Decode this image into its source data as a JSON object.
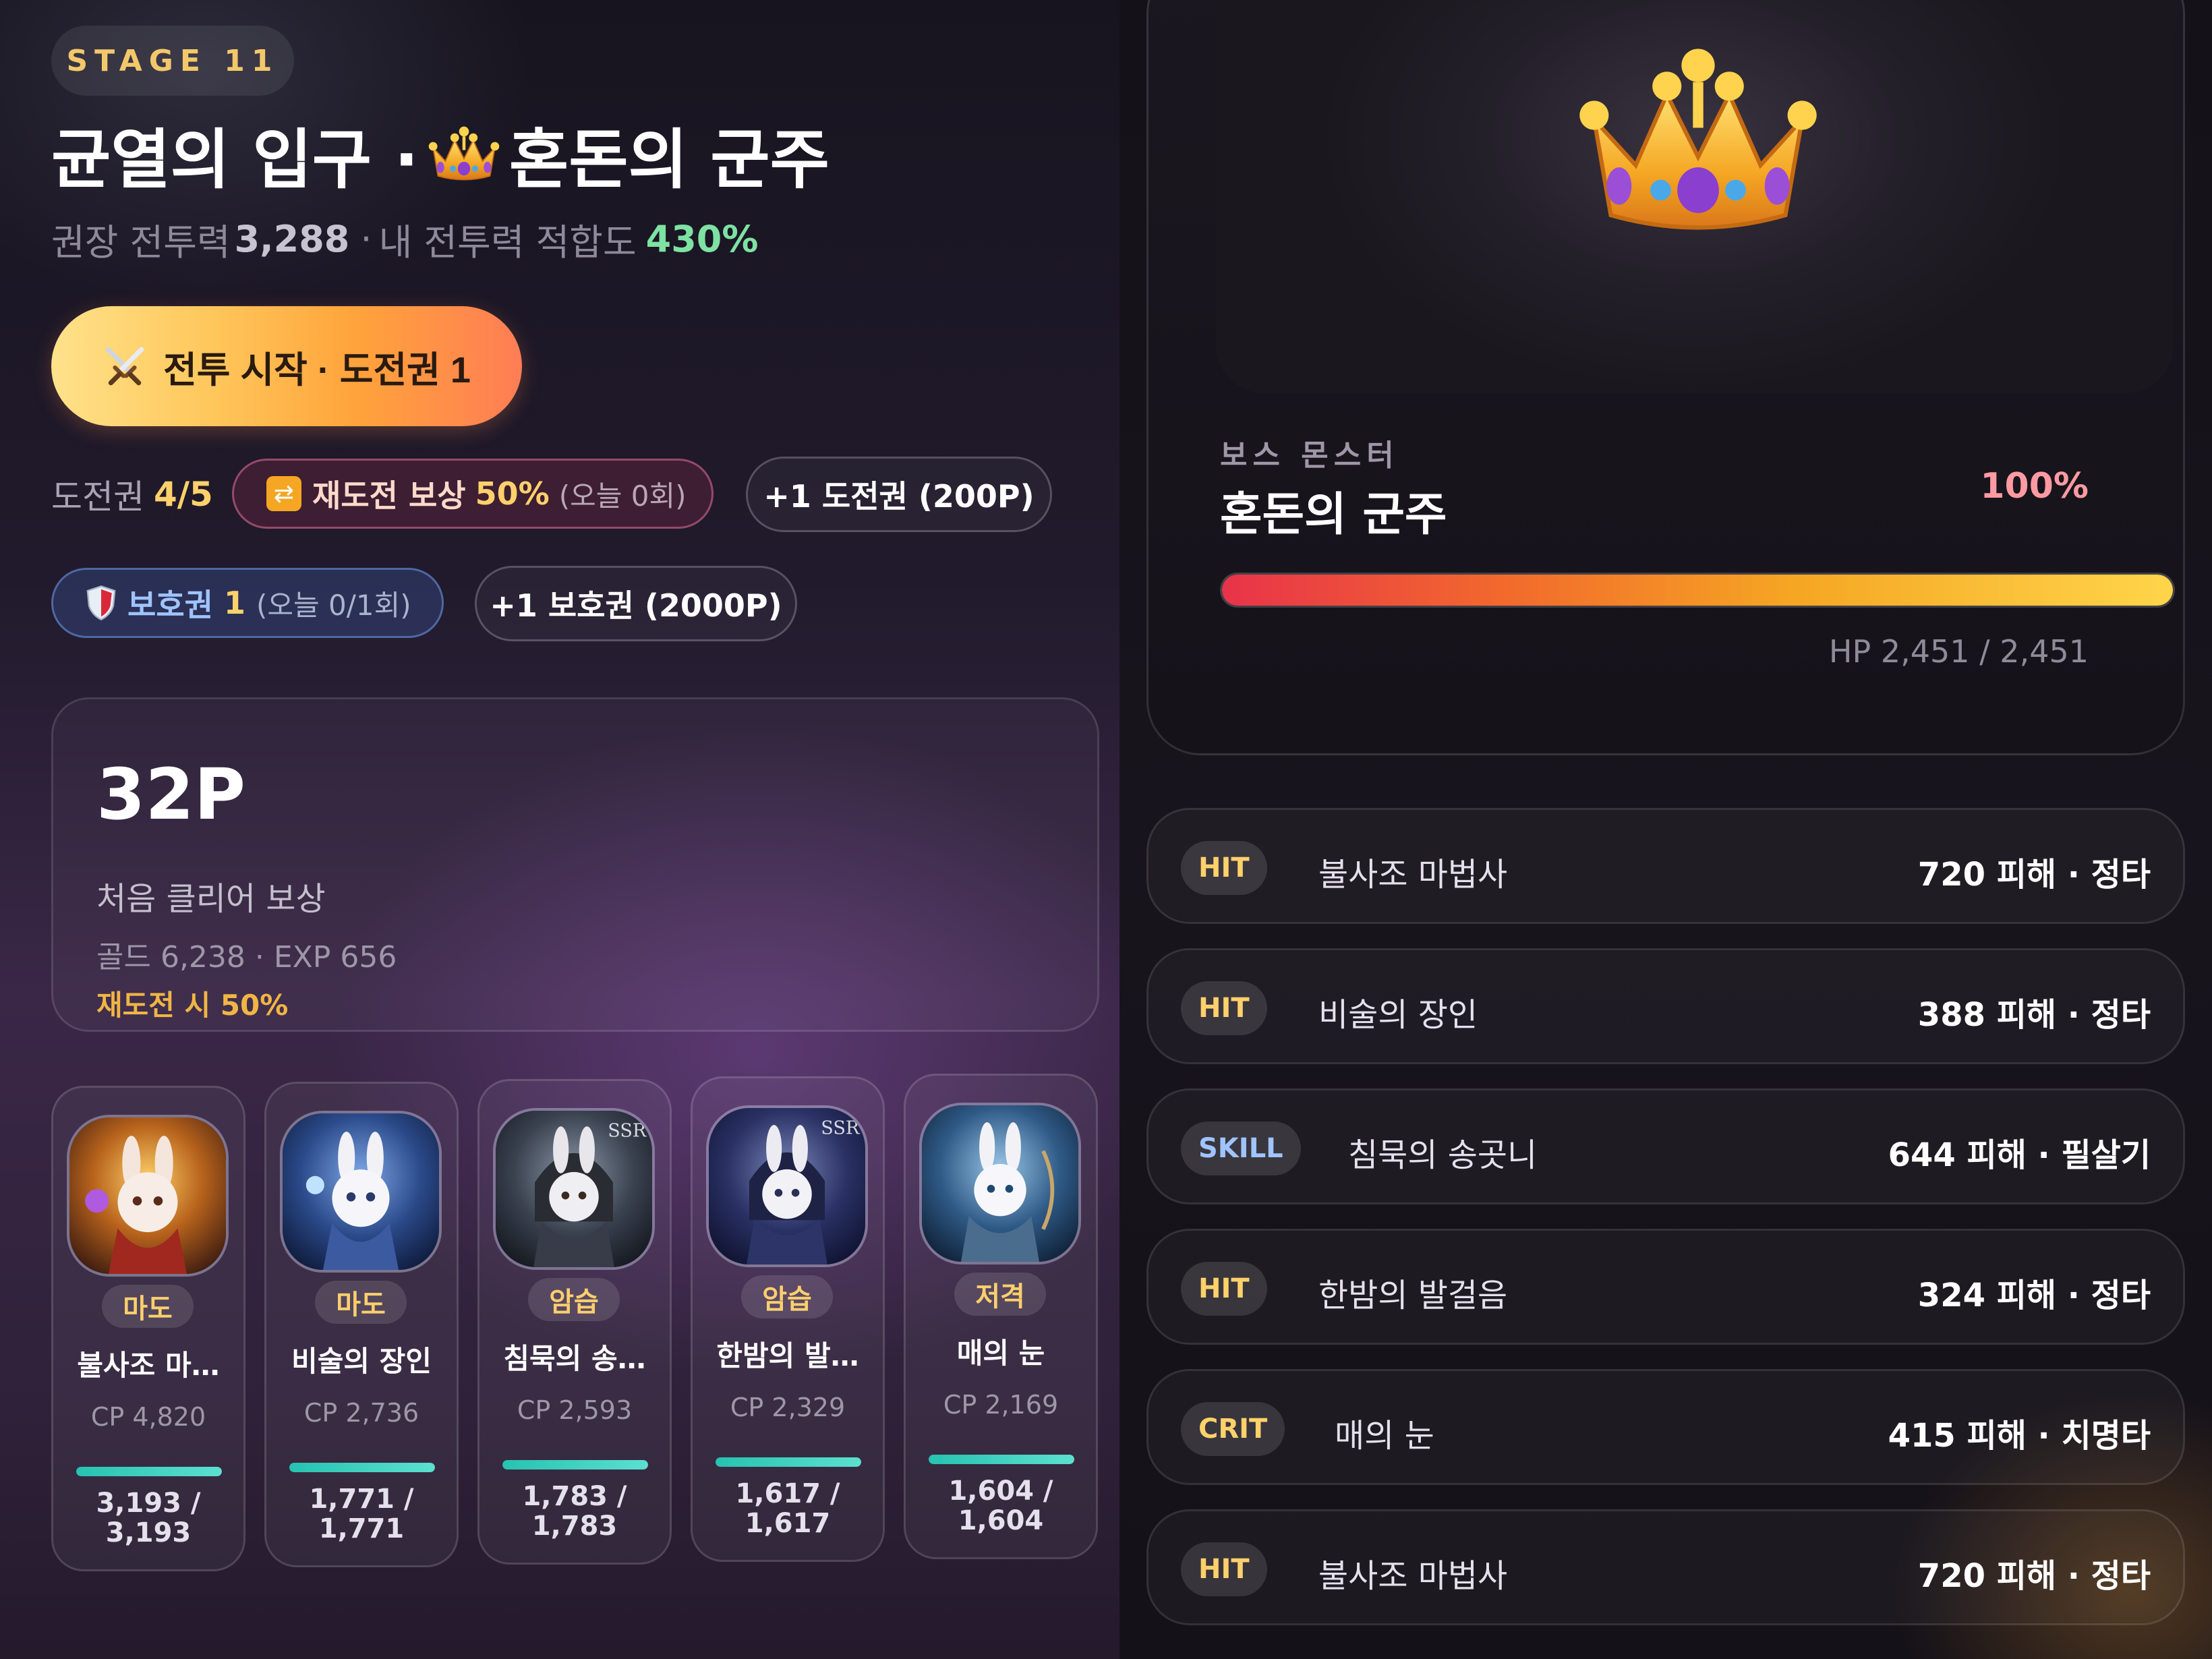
{
  "stage": {
    "label": "STAGE 11"
  },
  "header": {
    "title_left": "균열의 입구 ·",
    "title_right": "혼돈의 군주",
    "title_icon": "crown-icon",
    "recommend_label": "권장 전투력",
    "recommend_value": "3,288",
    "separator": "·",
    "fit_label": "내 전투력 적합도",
    "fit_value": "430%"
  },
  "start_button": {
    "icon": "crossed-swords-icon",
    "label": "전투 시작 · 도전권 1"
  },
  "tickets": {
    "label": "도전권",
    "value": "4/5",
    "retry_reward": {
      "icon": "repeat-icon",
      "label": "재도전 보상",
      "percent": "50%",
      "today": "(오늘 0회)"
    },
    "buy_ticket_label": "+1 도전권 (200P)"
  },
  "shields": {
    "icon": "shield-icon",
    "label": "보호권",
    "count": "1",
    "today": "(오늘 0/1회)",
    "buy_label": "+1 보호권 (2000P)"
  },
  "reward": {
    "points": "32P",
    "first_clear": "처음 클리어 보상",
    "gold_exp": "골드 6,238 · EXP 656",
    "retry_note": "재도전 시 50%"
  },
  "heroes": [
    {
      "role": "마도",
      "name": "불사조 마…",
      "cp": "CP 4,820",
      "hp_line1": "3,193 /",
      "hp_line2": "3,193",
      "hp_ratio": 1.0
    },
    {
      "role": "마도",
      "name": "비술의 장인",
      "cp": "CP 2,736",
      "hp_line1": "1,771 /",
      "hp_line2": "1,771",
      "hp_ratio": 1.0
    },
    {
      "role": "암습",
      "name": "침묵의 송…",
      "cp": "CP 2,593",
      "hp_line1": "1,783 /",
      "hp_line2": "1,783",
      "hp_ratio": 1.0
    },
    {
      "role": "암습",
      "name": "한밤의 발…",
      "cp": "CP 2,329",
      "hp_line1": "1,617 /",
      "hp_line2": "1,617",
      "hp_ratio": 1.0
    },
    {
      "role": "저격",
      "name": "매의 눈",
      "cp": "CP 2,169",
      "hp_line1": "1,604 /",
      "hp_line2": "1,604",
      "hp_ratio": 1.0
    }
  ],
  "boss": {
    "label": "보스 몬스터",
    "name": "혼돈의 군주",
    "icon": "crown-icon",
    "hp_percent": "100%",
    "hp_ratio": 1.0,
    "hp_text": "HP 2,451 / 2,451"
  },
  "battle_log": [
    {
      "tag": "HIT",
      "type": "hit",
      "attacker": "불사조 마법사",
      "result": "720 피해 · 정타"
    },
    {
      "tag": "HIT",
      "type": "hit",
      "attacker": "비술의 장인",
      "result": "388 피해 · 정타"
    },
    {
      "tag": "SKILL",
      "type": "skill",
      "attacker": "침묵의 송곳니",
      "result": "644 피해 · 필살기"
    },
    {
      "tag": "HIT",
      "type": "hit",
      "attacker": "한밤의 발걸음",
      "result": "324 피해 · 정타"
    },
    {
      "tag": "CRIT",
      "type": "crit",
      "attacker": "매의 눈",
      "result": "415 피해 · 치명타"
    },
    {
      "tag": "HIT",
      "type": "hit",
      "attacker": "불사조 마법사",
      "result": "720 피해 · 정타"
    }
  ],
  "colors": {
    "accent_gold": "#ffd16b",
    "fit_green": "#7ee2a3",
    "hp_teal": "#27c2b0",
    "boss_hp_red": "#e8334a",
    "boss_hp_yellow": "#ffd54a"
  }
}
